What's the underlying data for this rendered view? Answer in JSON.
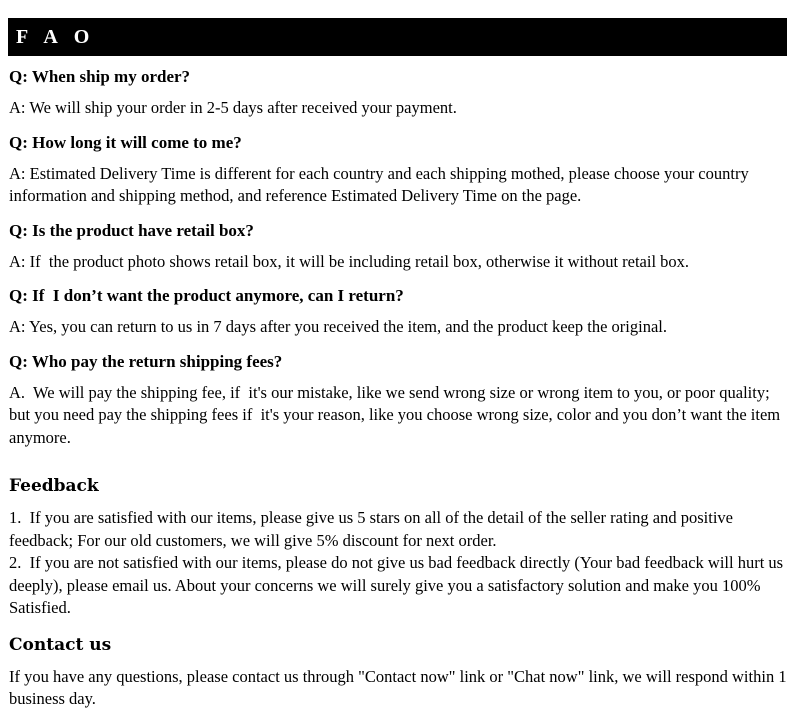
{
  "header": {
    "title": "F A O",
    "background_color": "#000000",
    "text_color": "#ffffff"
  },
  "faq": {
    "items": [
      {
        "question": "Q: When ship my order?",
        "answer": "A: We will ship your order in 2-5 days after received your payment."
      },
      {
        "question": "Q: How long it will come to me?",
        "answer": "A: Estimated Delivery Time is different for each country and each shipping mothed, please choose your country information and shipping method, and reference Estimated Delivery Time on the page."
      },
      {
        "question": "Q: Is the product have retail box?",
        "answer": "A: If  the product photo shows retail box, it will be including retail box, otherwise it without retail box."
      },
      {
        "question": "Q: If  I don’t want the product anymore, can I return?",
        "answer": "A: Yes, you can return to us in 7 days after you received the item, and the product keep the original."
      },
      {
        "question": "Q: Who pay the return shipping fees?",
        "answer": "A.  We will pay the shipping fee, if  it's our mistake, like we send wrong size or wrong item to you, or poor quality; but you need pay the shipping fees if  it's your reason, like you choose wrong size, color and you don’t want the item anymore."
      }
    ]
  },
  "feedback": {
    "heading": "Feedback",
    "item_1": "1.  If you are satisfied with our items, please give us 5 stars on all of the detail of the seller rating and positive feedback; For our old customers, we will give 5% discount for next order.",
    "item_2": "2.  If you are not satisfied with our items, please do not give us bad feedback directly (Your bad feedback will hurt us deeply), please email us. About your concerns we will surely give you a satisfactory solution and make you 100% Satisfied."
  },
  "contact": {
    "heading": "Contact us",
    "text": "If you have any questions, please contact us through \"Contact now\" link or \"Chat now\" link, we will respond within 1 business day."
  },
  "colors": {
    "page_background": "#ffffff",
    "text": "#000000",
    "banner": "#000000"
  }
}
